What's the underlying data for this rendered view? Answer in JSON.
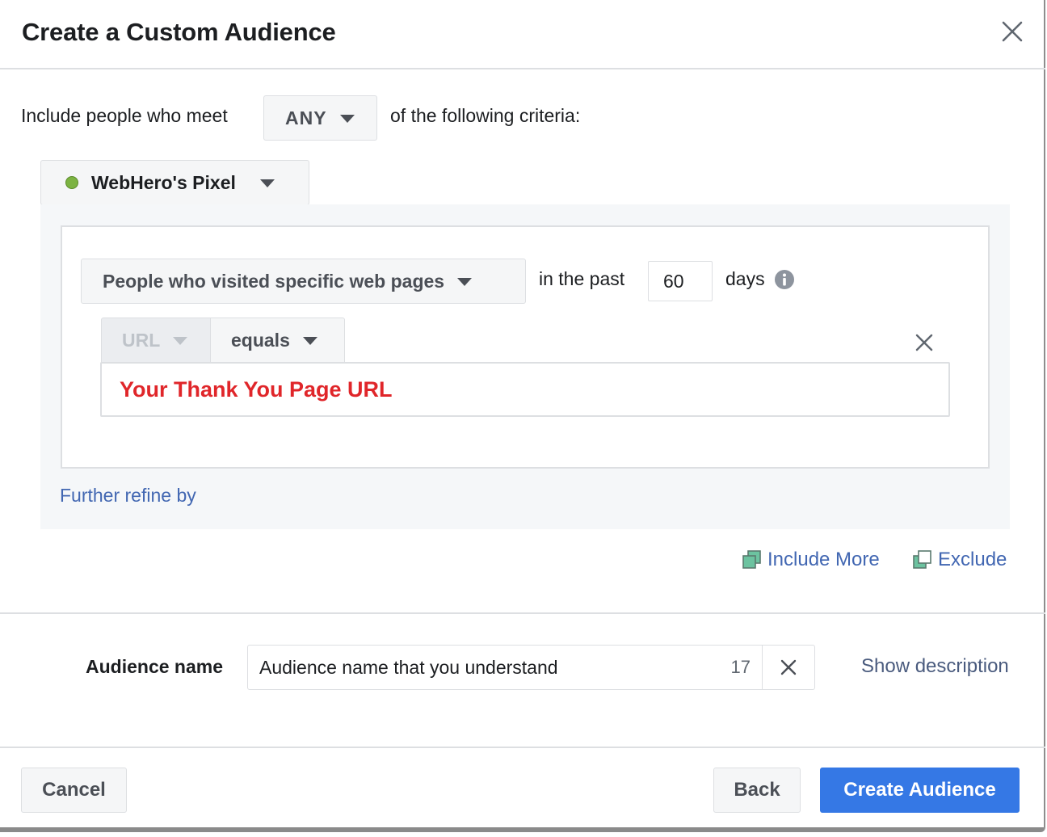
{
  "dialog": {
    "title": "Create a Custom Audience",
    "close_icon": "close-icon"
  },
  "criteria": {
    "prefix": "Include people who meet",
    "match_value": "ANY",
    "suffix": "of the following criteria:"
  },
  "source": {
    "name": "WebHero's Pixel",
    "status_color": "#7cb342"
  },
  "rule": {
    "event_value": "People who visited specific web pages",
    "in_the_past_label": "in the past",
    "days_value": "60",
    "days_label": "days",
    "info_icon": "info-icon",
    "field_value": "URL",
    "operator_value": "equals",
    "url_value": "Your Thank You Page URL",
    "url_color": "#e0262a",
    "remove_icon": "close-icon",
    "further_refine_label": "Further refine by"
  },
  "actions": {
    "include_more_label": "Include More",
    "exclude_label": "Exclude"
  },
  "audience_name": {
    "label": "Audience name",
    "value": "Audience name that you understand",
    "remaining_chars": "17",
    "clear_icon": "close-icon",
    "show_description_label": "Show description"
  },
  "footer": {
    "cancel_label": "Cancel",
    "back_label": "Back",
    "create_label": "Create Audience",
    "primary_color": "#3578e5"
  }
}
